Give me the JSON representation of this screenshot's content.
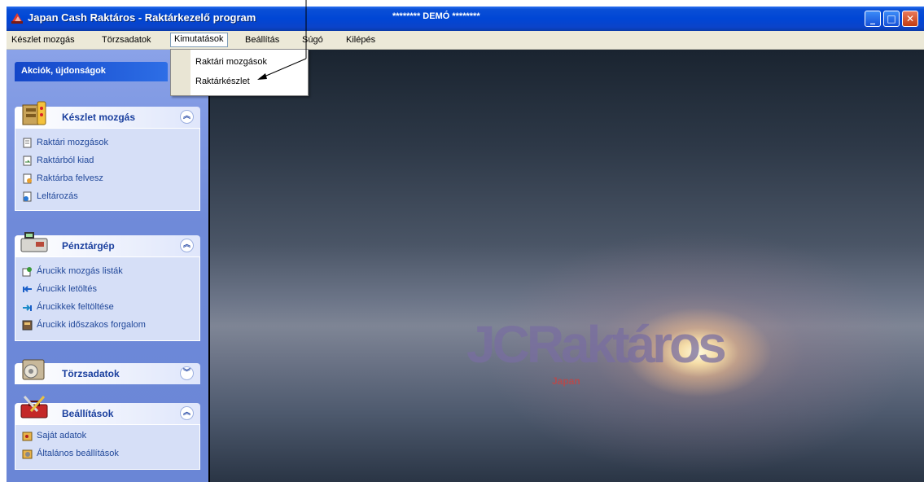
{
  "window": {
    "title": "Japan Cash Raktáros - Raktárkezelő program",
    "demo_label": "******** DEMÓ ********",
    "controls": {
      "minimize": "_",
      "maximize": "□",
      "close": "✕"
    }
  },
  "menubar": {
    "items": [
      {
        "label": "Készlet mozgás"
      },
      {
        "label": "Törzsadatok"
      },
      {
        "label": "Kimutatások"
      },
      {
        "label": "Beállítás"
      },
      {
        "label": "Súgó"
      },
      {
        "label": "Kilépés"
      }
    ],
    "active": "Kimutatások"
  },
  "dropdown": {
    "items": [
      {
        "label": "Raktári mozgások"
      },
      {
        "label": "Raktárkészlet"
      }
    ]
  },
  "sidebar": {
    "actions_title": "Akciók, újdonságok",
    "groups": [
      {
        "title": "Készlet mozgás",
        "chevron": "collapse",
        "links": [
          "Raktári mozgások",
          "Raktárból kiad",
          "Raktárba felvesz",
          "Leltározás"
        ]
      },
      {
        "title": "Pénztárgép",
        "chevron": "collapse",
        "links": [
          "Árucikk mozgás listák",
          "Árucikk letöltés",
          "Árucikkek feltöltése",
          "Árucikk időszakos forgalom"
        ]
      },
      {
        "title": "Törzsadatok",
        "chevron": "expand",
        "links": []
      },
      {
        "title": "Beállítások",
        "chevron": "collapse",
        "links": [
          "Saját adatok",
          "Általános beállítások"
        ]
      }
    ]
  },
  "background": {
    "logo_text": "JCRaktáros",
    "logo_sub": "Japan"
  },
  "colors": {
    "titlebar": "#0046d5",
    "menubar": "#ece9d8",
    "sidebar": "#6f8ad9",
    "link": "#21489a",
    "group_title": "#1a3f9e"
  }
}
